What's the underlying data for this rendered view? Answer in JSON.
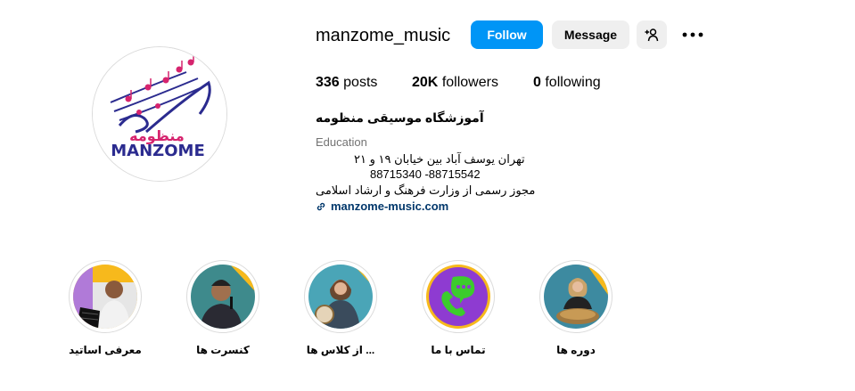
{
  "profile": {
    "username": "manzome_music",
    "logo_text": "MANZOME",
    "logo_persian": "منظومه",
    "follow_label": "Follow",
    "message_label": "Message",
    "posts_count": "336",
    "posts_label": "posts",
    "followers_count": "20K",
    "followers_label": "followers",
    "following_count": "0",
    "following_label": "following",
    "full_name": "آموزشگاه موسیقی منظومه",
    "category": "Education",
    "bio": [
      "تهران یوسف آباد بین خیابان ۱۹ و ۲۱",
      "88715340 -88715542",
      "مجوز رسمی از وزارت فرهنگ و ارشاد اسلامی"
    ],
    "link": "manzome-music.com"
  },
  "highlights": [
    {
      "label": "معرفی اساتید",
      "icon": "teacher-photo"
    },
    {
      "label": "کنسرت ها",
      "icon": "singer-photo"
    },
    {
      "label": "از کلاس ها ...",
      "icon": "class-photo"
    },
    {
      "label": "تماس با ما",
      "icon": "phone-chat-icon"
    },
    {
      "label": "دوره ها",
      "icon": "course-photo"
    }
  ],
  "colors": {
    "accent": "#0095f6",
    "logo_blue": "#2b2b8f",
    "logo_pink": "#d6246e",
    "highlight_yellow": "#f7b91c",
    "contact_purple": "#8e3bd1",
    "contact_green": "#3ccc2c"
  }
}
